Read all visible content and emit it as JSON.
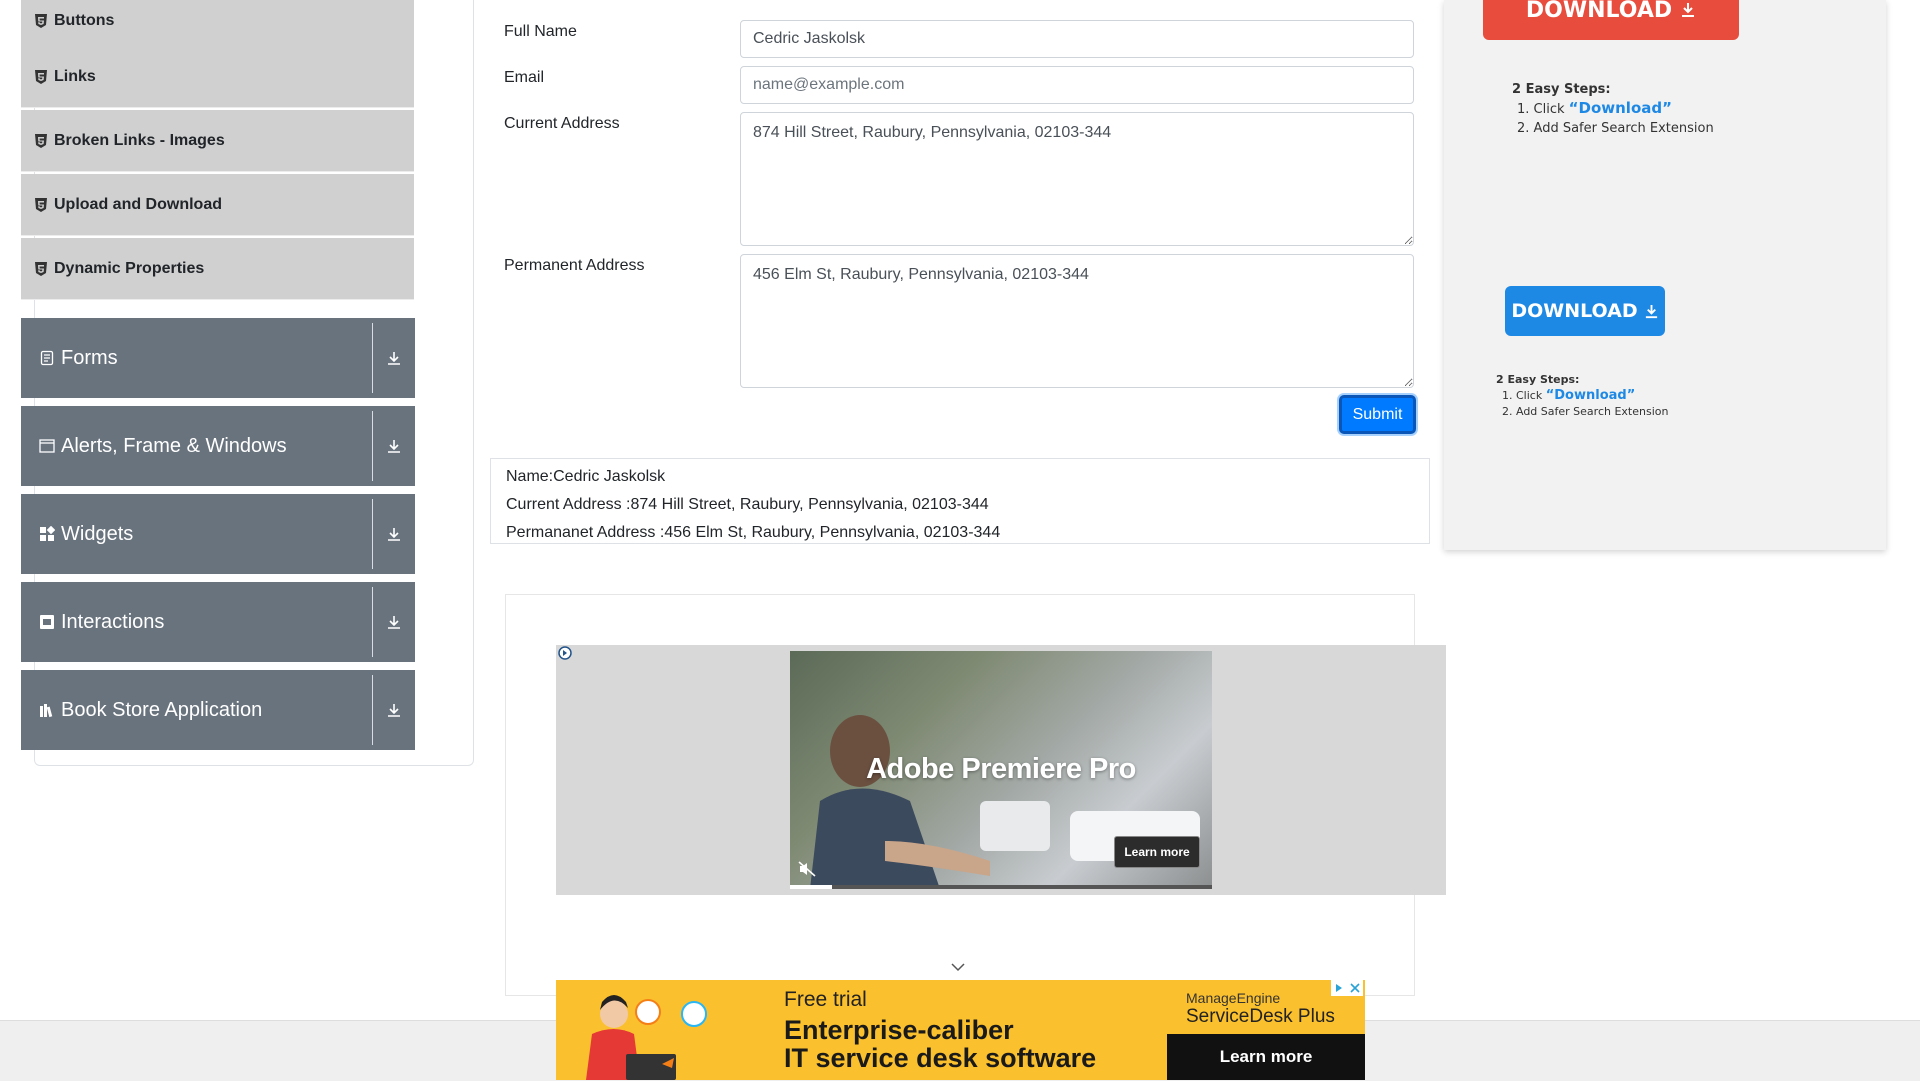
{
  "sidebar": {
    "sub_items": [
      {
        "label": "Buttons"
      },
      {
        "label": "Links"
      },
      {
        "label": "Broken Links - Images"
      },
      {
        "label": "Upload and Download"
      },
      {
        "label": "Dynamic Properties"
      }
    ],
    "groups": [
      {
        "label": "Forms",
        "icon": "form-icon"
      },
      {
        "label": "Alerts, Frame & Windows",
        "icon": "window-icon"
      },
      {
        "label": "Widgets",
        "icon": "widgets-icon"
      },
      {
        "label": "Interactions",
        "icon": "interactions-icon"
      },
      {
        "label": "Book Store Application",
        "icon": "books-icon"
      }
    ]
  },
  "form": {
    "full_name_label": "Full Name",
    "full_name_value": "Cedric Jaskolsk",
    "email_label": "Email",
    "email_placeholder": "name@example.com",
    "current_address_label": "Current Address",
    "current_address_value": "874 Hill Street, Raubury, Pennsylvania, 02103-344",
    "permanent_address_label": "Permanent Address",
    "permanent_address_value": "456 Elm St, Raubury, Pennsylvania, 02103-344",
    "submit_label": "Submit"
  },
  "output": {
    "name": "Name:Cedric Jaskolsk",
    "current_address": "Current Address :874 Hill Street, Raubury, Pennsylvania, 02103-344",
    "permanent_address": "Permananet Address :456 Elm St, Raubury, Pennsylvania, 02103-344"
  },
  "video_ad": {
    "title": "Adobe Premiere Pro",
    "learn_more": "Learn more",
    "progress": 0.1
  },
  "right_ad": {
    "download_label": "DOWNLOAD",
    "steps_title": "2 Easy Steps:",
    "step1_prefix": "1. Click ",
    "step1_link": "“Download”",
    "step2": "2. Add Safer Search Extension",
    "colors": {
      "red": "#e74c3c",
      "blue": "#1e88e5"
    }
  },
  "banner": {
    "free_trial": "Free trial",
    "headline1": "Enterprise-caliber",
    "headline2": "IT service desk software",
    "brand_top": "ManageEngine",
    "brand_bottom": "ServiceDesk Plus",
    "learn_more": "Learn more"
  }
}
